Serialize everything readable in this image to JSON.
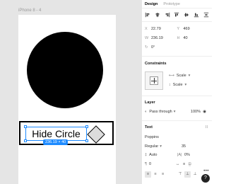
{
  "canvas": {
    "frame_label": "iPhone 8 - 4",
    "button": {
      "text": "Hide Circle",
      "size_badge": "236.19 × 40"
    }
  },
  "panel": {
    "tabs": [
      {
        "label": "Design",
        "active": true
      },
      {
        "label": "Prototype",
        "active": false
      }
    ],
    "position": {
      "x_label": "X",
      "x": "22.79",
      "y_label": "Y",
      "y": "469",
      "w_label": "W",
      "w": "236.19",
      "h_label": "H",
      "h": "40",
      "rotation": "0°"
    },
    "constraints": {
      "title": "Constraints",
      "horizontal": "Scale",
      "vertical": "Scale"
    },
    "layer": {
      "title": "Layer",
      "blend": "Pass through",
      "opacity": "100%"
    },
    "text": {
      "title": "Text",
      "font": "Poppins",
      "weight": "Regular",
      "size": "35",
      "line_height": "Auto",
      "letter_spacing": "0%",
      "paragraph_spacing": "0"
    }
  },
  "colors": {
    "selection": "#1e8bff",
    "circle": "#000000"
  },
  "icons": [
    "align-left-icon",
    "align-center-h-icon",
    "align-right-icon",
    "align-top-icon",
    "align-middle-icon",
    "align-bottom-icon",
    "distribute-icon",
    "plus-icon",
    "eye-icon",
    "help-icon"
  ]
}
